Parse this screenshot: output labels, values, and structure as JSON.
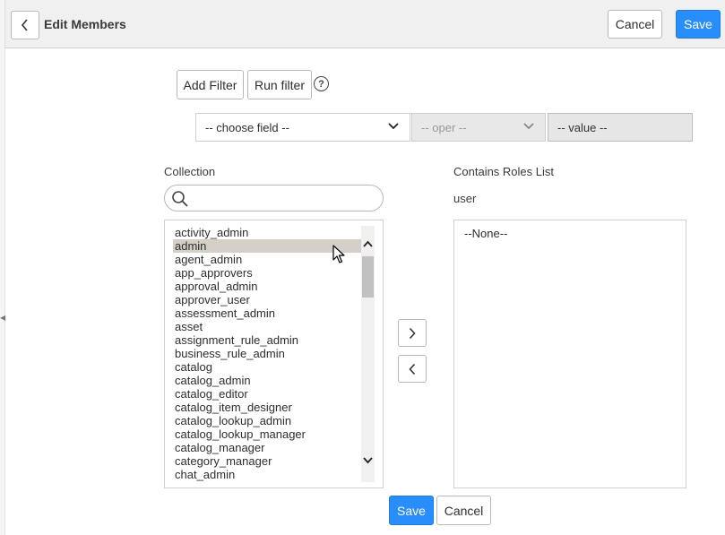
{
  "header": {
    "title": "Edit Members",
    "cancel_label": "Cancel",
    "save_label": "Save"
  },
  "filter": {
    "add_filter_label": "Add Filter",
    "run_filter_label": "Run filter",
    "help_glyph": "?",
    "field_select": "-- choose field --",
    "oper_select": "-- oper --",
    "value_field": "-- value --"
  },
  "collection": {
    "label": "Collection",
    "search_placeholder": "",
    "items": [
      "activity_admin",
      "admin",
      "agent_admin",
      "app_approvers",
      "approval_admin",
      "approver_user",
      "assessment_admin",
      "asset",
      "assignment_rule_admin",
      "business_rule_admin",
      "catalog",
      "catalog_admin",
      "catalog_editor",
      "catalog_item_designer",
      "catalog_lookup_admin",
      "catalog_lookup_manager",
      "catalog_manager",
      "category_manager",
      "chat_admin"
    ],
    "selected_item": "admin"
  },
  "roles": {
    "label": "Contains Roles List",
    "subtitle": "user",
    "empty_text": "--None--"
  },
  "footer": {
    "save_label": "Save",
    "cancel_label": "Cancel"
  },
  "colors": {
    "primary": "#278efc",
    "selected_row": "#d4d0c8",
    "header_bg": "#f0f0f0"
  }
}
